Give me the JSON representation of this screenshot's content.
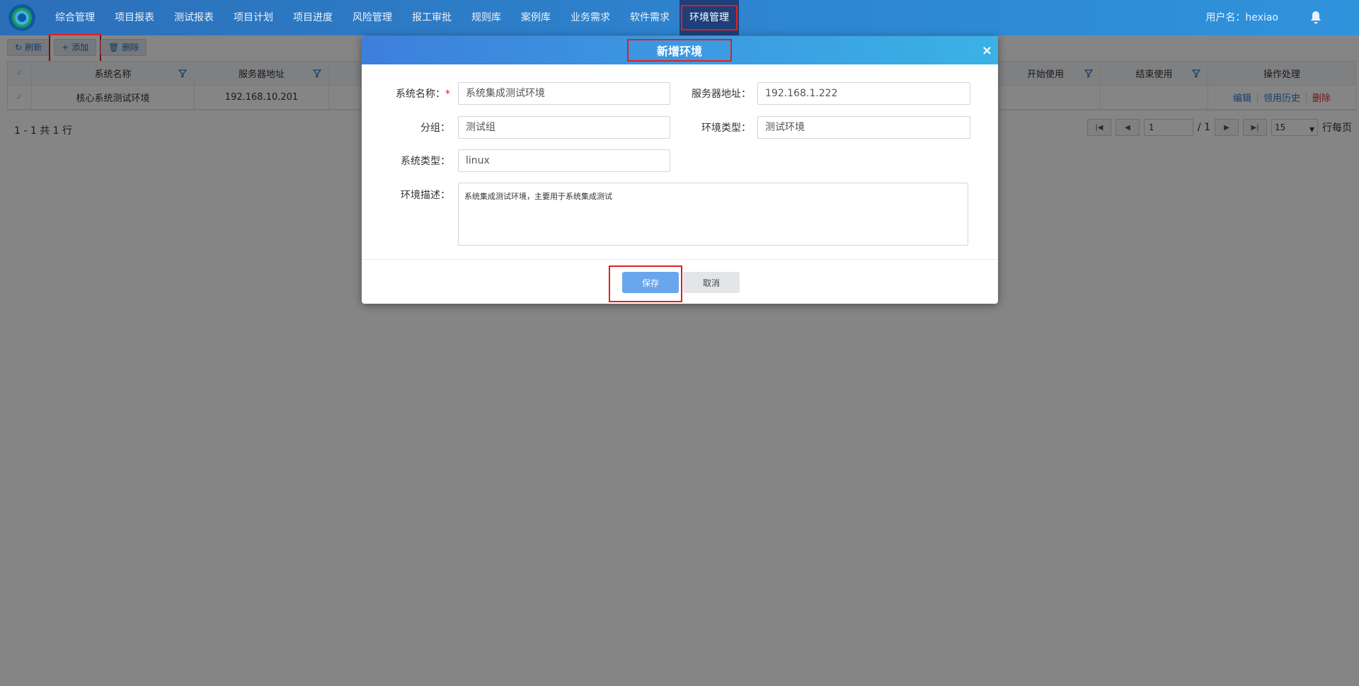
{
  "nav": {
    "items": [
      "综合管理",
      "项目报表",
      "测试报表",
      "项目计划",
      "项目进度",
      "风险管理",
      "报工审批",
      "规则库",
      "案例库",
      "业务需求",
      "软件需求",
      "环境管理"
    ],
    "user_label": "用户名：hexiao"
  },
  "toolbar": {
    "refresh": "刷新",
    "add": "添加",
    "delete": "删除"
  },
  "table": {
    "headers": {
      "system_name": "系统名称",
      "server_address": "服务器地址",
      "start_use": "开始使用",
      "end_use": "结束使用",
      "operations": "操作处理"
    },
    "row": {
      "system_name": "核心系统测试环境",
      "server_address": "192.168.10.201",
      "edit": "编辑",
      "history": "领用历史",
      "delete": "删除"
    }
  },
  "pager": {
    "summary": "1 - 1 共 1 行",
    "page": "1",
    "total": "/ 1",
    "page_size": "15",
    "per_page_label": "行每页"
  },
  "dialog": {
    "title": "新增环境",
    "close": "×",
    "fields": {
      "system_name_label": "系统名称：",
      "system_name_required": "*",
      "system_name_value": "系统集成测试环境",
      "server_address_label": "服务器地址：",
      "server_address_value": "192.168.1.222",
      "group_label": "分组：",
      "group_value": "测试组",
      "env_type_label": "环境类型：",
      "env_type_value": "测试环境",
      "os_type_label": "系统类型：",
      "os_type_value": "linux",
      "desc_label": "环境描述：",
      "desc_value": "系统集成测试环境，主要用于系统集成测试"
    },
    "save": "保存",
    "cancel": "取消"
  },
  "colors": {
    "highlight": "#e02020",
    "primary": "#3d7fdc"
  }
}
